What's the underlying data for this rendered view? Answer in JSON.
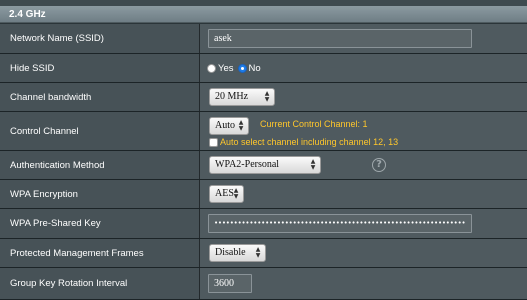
{
  "section": {
    "title": "2.4 GHz"
  },
  "rows": {
    "ssid": {
      "label": "Network Name (SSID)",
      "value": "asek"
    },
    "hide_ssid": {
      "label": "Hide SSID",
      "yes_label": "Yes",
      "no_label": "No",
      "selected": "No"
    },
    "bandwidth": {
      "label": "Channel bandwidth",
      "value": "20 MHz"
    },
    "control_channel": {
      "label": "Control Channel",
      "value": "Auto",
      "current_text": "Current Control Channel: 1",
      "auto_select_text": "Auto select channel including channel 12, 13",
      "auto_select_checked": false
    },
    "auth_method": {
      "label": "Authentication Method",
      "value": "WPA2-Personal",
      "help_icon": "question-icon"
    },
    "wpa_encryption": {
      "label": "WPA Encryption",
      "value": "AES"
    },
    "psk": {
      "label": "WPA Pre-Shared Key",
      "value": "••••••••••••••••••••••••••••••••••••••••••••••••••••••••••••••••"
    },
    "pmf": {
      "label": "Protected Management Frames",
      "value": "Disable"
    },
    "group_key": {
      "label": "Group Key Rotation Interval",
      "value": "3600"
    }
  }
}
